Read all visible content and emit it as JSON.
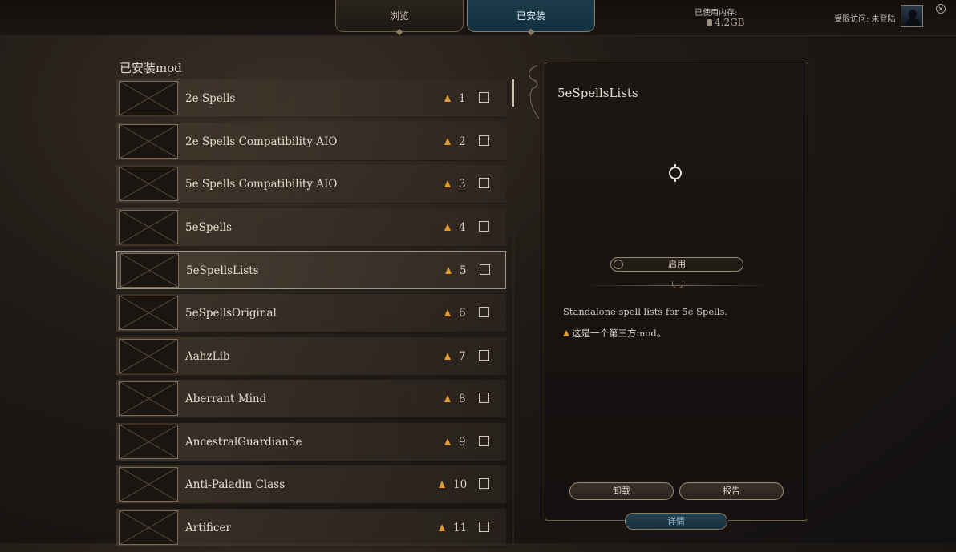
{
  "header": {
    "tabs": [
      {
        "label": "浏览"
      },
      {
        "label": "已安装"
      }
    ],
    "memory_label": "已使用内存:",
    "memory_value": "4.2GB",
    "account_status": "受限访问: 未登陆"
  },
  "section_title": "已安装mod",
  "mods": [
    {
      "name": "2e Spells",
      "order": "1",
      "warning": true
    },
    {
      "name": "2e Spells Compatibility AIO",
      "order": "2",
      "warning": true
    },
    {
      "name": "5e Spells Compatibility AIO",
      "order": "3",
      "warning": true
    },
    {
      "name": "5eSpells",
      "order": "4",
      "warning": true
    },
    {
      "name": "5eSpellsLists",
      "order": "5",
      "warning": true,
      "selected": true
    },
    {
      "name": "5eSpellsOriginal",
      "order": "6",
      "warning": true
    },
    {
      "name": "AahzLib",
      "order": "7",
      "warning": true
    },
    {
      "name": "Aberrant Mind",
      "order": "8",
      "warning": true
    },
    {
      "name": "AncestralGuardian5e",
      "order": "9",
      "warning": true
    },
    {
      "name": "Anti-Paladin Class",
      "order": "10",
      "warning": true
    },
    {
      "name": "Artificer",
      "order": "11",
      "warning": true
    }
  ],
  "detail": {
    "title": "5eSpellsLists",
    "toggle_label": "启用",
    "description": "Standalone spell lists for 5e Spells.",
    "third_party_note": "这是一个第三方mod。",
    "uninstall_label": "卸载",
    "report_label": "报告",
    "details_label": "详情"
  },
  "colors": {
    "warning": "#e59a2a",
    "selected_tab": "#1c3a48",
    "accent_border": "#8c7a60"
  }
}
